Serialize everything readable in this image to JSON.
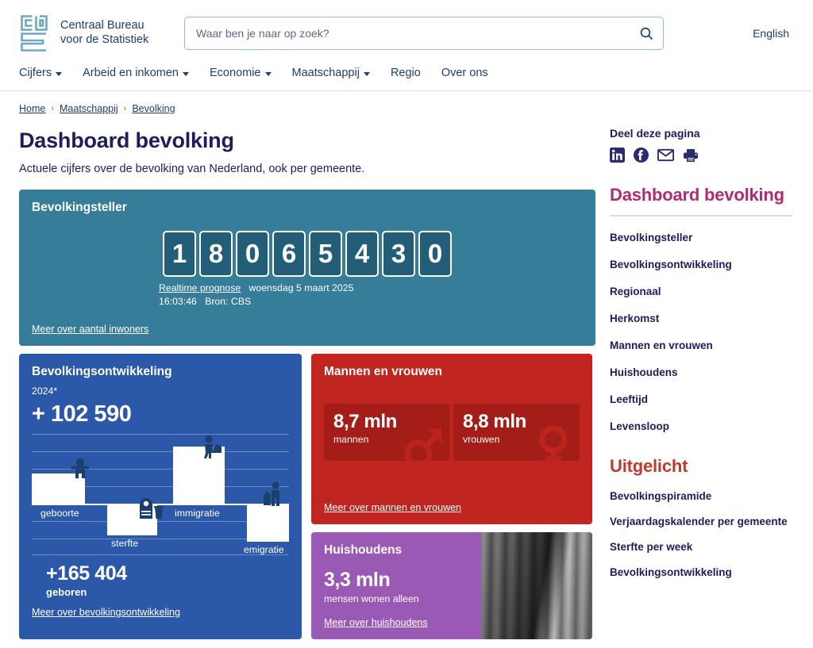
{
  "header": {
    "logo_line1": "Centraal Bureau",
    "logo_line2": "voor de Statistiek",
    "logo_icon": "cbs-logo-icon",
    "search_placeholder": "Waar ben je naar op zoek?",
    "search_value": "",
    "search_icon": "search-icon",
    "language_link": "English"
  },
  "nav": {
    "items": [
      {
        "label": "Cijfers",
        "has_caret": true
      },
      {
        "label": "Arbeid en inkomen",
        "has_caret": true
      },
      {
        "label": "Economie",
        "has_caret": true
      },
      {
        "label": "Maatschappij",
        "has_caret": true
      },
      {
        "label": "Regio",
        "has_caret": false
      },
      {
        "label": "Over ons",
        "has_caret": false
      }
    ]
  },
  "breadcrumb": {
    "items": [
      "Home",
      "Maatschappij",
      "Bevolking"
    ],
    "separator": "›"
  },
  "page": {
    "title": "Dashboard bevolking",
    "subtitle": "Actuele cijfers over de bevolking van Nederland, ook per gemeente."
  },
  "counter_card": {
    "title": "Bevolkingsteller",
    "digits": [
      "1",
      "8",
      "0",
      "6",
      "5",
      "4",
      "3",
      "0"
    ],
    "prognosis_link": "Realtime prognose",
    "date": "woensdag 5 maart 2025",
    "time": "16:03:46",
    "source": "Bron: CBS",
    "footer_link": "Meer over aantal inwoners",
    "bg_color": "#367d99",
    "digit_bg_color": "#235e78"
  },
  "development_card": {
    "title": "Bevolkingsontwikkeling",
    "year": "2024*",
    "headline": "+ 102 590",
    "births_value": "+165 404",
    "births_label": "geboren",
    "footer_link": "Meer over bevolkingsontwikkeling",
    "bg_color": "#2b58a8"
  },
  "gender_card": {
    "title": "Mannen en vrouwen",
    "men_value": "8,7 mln",
    "men_label": "mannen",
    "men_icon": "mars-symbol-icon",
    "women_value": "8,8 mln",
    "women_label": "vrouwen",
    "women_icon": "venus-symbol-icon",
    "footer_link": "Meer over mannen en vrouwen",
    "bg_color": "#c12520"
  },
  "households_card": {
    "title": "Huishoudens",
    "value": "3,3 mln",
    "label": "mensen wonen alleen",
    "footer_link": "Meer over huishoudens",
    "bg_color": "#9b59b6"
  },
  "sidebar": {
    "share_title": "Deel deze pagina",
    "share_icons": [
      "linkedin-icon",
      "facebook-icon",
      "email-icon",
      "print-icon"
    ],
    "dashboard_heading": "Dashboard bevolking",
    "dashboard_links": [
      "Bevolkingsteller",
      "Bevolkingsontwikkeling",
      "Regionaal",
      "Herkomst",
      "Mannen en vrouwen",
      "Huishoudens",
      "Leeftijd",
      "Levensloop"
    ],
    "featured_heading": "Uitgelicht",
    "featured_links": [
      "Bevolkingspiramide",
      "Verjaardagskalender per gemeente",
      "Sterfte per week",
      "Bevolkingsontwikkeling"
    ]
  },
  "chart_data": {
    "type": "bar",
    "title": "Bevolkingsontwikkeling",
    "subtitle": "2024*",
    "categories": [
      "geboorte",
      "sterfte",
      "immigratie",
      "emigratie"
    ],
    "values": [
      165404,
      -172000,
      310000,
      -200000
    ],
    "value_labels": [
      "+165 404",
      "",
      "",
      ""
    ],
    "net_total": 102590,
    "net_label": "+ 102 590",
    "icons": [
      "baby-icon",
      "grave-icon",
      "immigrant-icon",
      "emigrant-icon"
    ],
    "direction": [
      "up",
      "down",
      "up",
      "down"
    ],
    "grid": true,
    "gridline_count": 8,
    "xlabel": "",
    "ylabel": "",
    "legend": "none"
  }
}
